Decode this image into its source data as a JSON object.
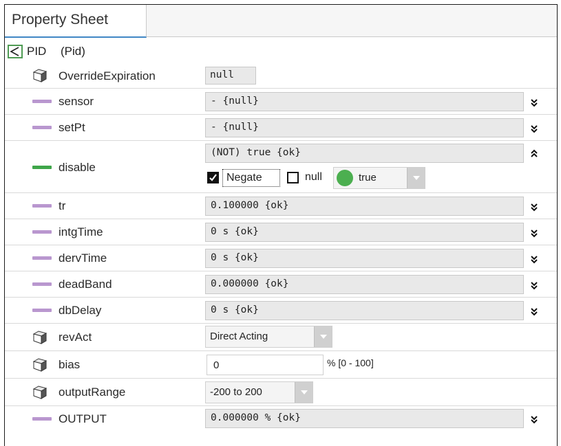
{
  "tab": {
    "label": "Property Sheet"
  },
  "root": {
    "name": "PID",
    "type": "(Pid)"
  },
  "properties": {
    "override_expiration": {
      "name": "OverrideExpiration",
      "value": "null"
    },
    "sensor": {
      "name": "sensor",
      "value": "- {null}"
    },
    "setpt": {
      "name": "setPt",
      "value": "- {null}"
    },
    "disable": {
      "name": "disable",
      "value": "(NOT) true {ok}",
      "negate_label": "Negate",
      "negate_checked": true,
      "null_label": "null",
      "null_checked": false,
      "bool_value": "true",
      "bool_color": "#4caf50"
    },
    "tr": {
      "name": "tr",
      "value": "0.100000 {ok}"
    },
    "intgtime": {
      "name": "intgTime",
      "value": "0 s {ok}"
    },
    "dervtime": {
      "name": "dervTime",
      "value": "0 s {ok}"
    },
    "deadband": {
      "name": "deadBand",
      "value": "0.000000 {ok}"
    },
    "dbdelay": {
      "name": "dbDelay",
      "value": "0 s {ok}"
    },
    "revact": {
      "name": "revAct",
      "selected": "Direct Acting"
    },
    "bias": {
      "name": "bias",
      "value": "0",
      "unit_range": "% [0 - 100]"
    },
    "outputrange": {
      "name": "outputRange",
      "selected": "-200 to 200"
    },
    "output": {
      "name": "OUTPUT",
      "value": "0.000000 % {ok}"
    }
  },
  "colors": {
    "link_purple": "#b997cf",
    "link_green": "#3fa64a",
    "tab_accent": "#3f86c4"
  },
  "icons": {
    "root": "collapse-triangle-icon",
    "cube": "component-cube-icon",
    "link_bar": "slot-link-bar-icon",
    "expand": "double-chevron-down-icon",
    "collapse": "double-chevron-up-icon"
  }
}
